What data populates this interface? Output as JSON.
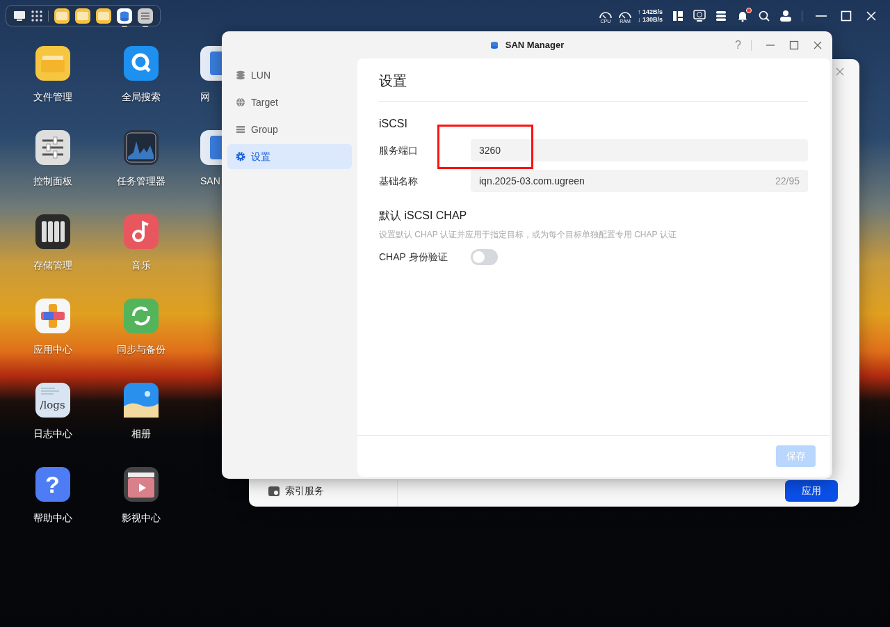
{
  "top_bar": {
    "dock_apps": [
      {
        "kind": "folder",
        "running": false
      },
      {
        "kind": "folder",
        "running": false
      },
      {
        "kind": "folder",
        "running": false
      },
      {
        "kind": "san",
        "running": true
      },
      {
        "kind": "control",
        "running": true
      }
    ],
    "cpu_label": "CPU",
    "ram_label": "RAM",
    "upload": "↑ 142B/s",
    "download": "↓ 130B/s",
    "notifications": {
      "unread": true
    }
  },
  "desktop_icons": [
    {
      "kind": "folder",
      "label": "文件管理"
    },
    {
      "kind": "search",
      "label": "全局搜索"
    },
    {
      "kind": "drive",
      "label": "网"
    },
    {
      "kind": "sliders",
      "label": "控制面板"
    },
    {
      "kind": "chart",
      "label": "任务管理器"
    },
    {
      "kind": "drive",
      "label": "SAN"
    },
    {
      "kind": "storage",
      "label": "存储管理"
    },
    {
      "kind": "music",
      "label": "音乐"
    },
    {
      "kind": "blank"
    },
    {
      "kind": "apps",
      "label": "应用中心"
    },
    {
      "kind": "sync",
      "label": "同步与备份"
    },
    {
      "kind": "blank"
    },
    {
      "kind": "logs",
      "label": "日志中心",
      "icon_text": "/logs"
    },
    {
      "kind": "photos",
      "label": "相册"
    },
    {
      "kind": "blank"
    },
    {
      "kind": "help",
      "label": "帮助中心",
      "icon_text": "?"
    },
    {
      "kind": "video",
      "label": "影视中心"
    }
  ],
  "background_window": {
    "sidebar_item": "索引服务",
    "button": "应用"
  },
  "window": {
    "title": "SAN Manager",
    "help": "?",
    "sidebar": [
      {
        "kind": "database",
        "label": "LUN",
        "selected": false
      },
      {
        "kind": "globe",
        "label": "Target",
        "selected": false
      },
      {
        "kind": "list",
        "label": "Group",
        "selected": false
      },
      {
        "kind": "gear",
        "label": "设置",
        "selected": true
      }
    ],
    "page_title": "设置",
    "iscsi": {
      "heading": "iSCSI",
      "fields": [
        {
          "label": "服务端口",
          "value": "3260"
        },
        {
          "label": "基础名称",
          "value": "iqn.2025-03.com.ugreen",
          "counter": "22/95"
        }
      ]
    },
    "chap": {
      "heading": "默认 iSCSI CHAP",
      "hint": "设置默认 CHAP 认证并应用于指定目标，或为每个目标单独配置专用 CHAP 认证",
      "toggle_label": "CHAP 身份验证",
      "on": false
    },
    "save_button": {
      "label": "保存",
      "disabled": true
    }
  },
  "annotations": [
    {
      "kind": "rectangle"
    }
  ]
}
